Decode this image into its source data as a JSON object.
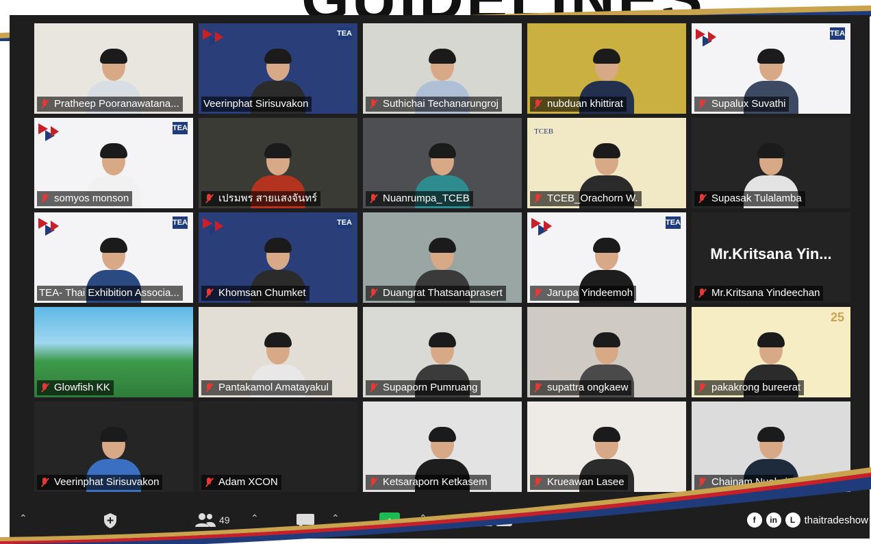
{
  "banner": {
    "text": "GUIDELINES"
  },
  "participants": [
    {
      "name": "Pratheep Pooranawatana...",
      "bg": "#e9e6df",
      "shirt": "#d9dde4",
      "muted": true
    },
    {
      "name": "Veerinphat Sirisuvakon",
      "bg": "#2a3f7a",
      "shirt": "#2b2b2b",
      "muted": false,
      "active": true,
      "logo": "TEA"
    },
    {
      "name": "Suthichai Techanarungroj",
      "bg": "#d7d7d2",
      "shirt": "#aebfd6",
      "muted": true
    },
    {
      "name": "nubduan khittirat",
      "bg": "#c9b040",
      "shirt": "#23314f",
      "muted": true
    },
    {
      "name": "Supalux Suvathi",
      "bg": "#f4f4f6",
      "shirt": "#3c4a63",
      "muted": true,
      "logo": "TEA"
    },
    {
      "name": "somyos monson",
      "bg": "#f4f4f6",
      "shirt": "#f1f1f1",
      "muted": true,
      "logo": "TEA"
    },
    {
      "name": "เปรมพร สายแสงจันทร์",
      "bg": "#3b3b36",
      "shirt": "#b3331f",
      "muted": true
    },
    {
      "name": "Nuanrumpa_TCEB",
      "bg": "#4d4f52",
      "shirt": "#2e8c8f",
      "muted": true
    },
    {
      "name": "TCEB_Orachorn W.",
      "bg": "#f1e8c6",
      "shirt": "#2b2b2b",
      "muted": true,
      "logo": "TCEB"
    },
    {
      "name": "Supasak Tulalamba",
      "bg": "#252525",
      "shirt": "#e3e3e3",
      "muted": true
    },
    {
      "name": "TEA- Thai Exhibition Associa...",
      "bg": "#f4f4f6",
      "shirt": "#2c4a82",
      "muted": false,
      "logo": "TEA"
    },
    {
      "name": "Khomsan Chumket",
      "bg": "#2a3f7a",
      "shirt": "#2b2b2b",
      "muted": true,
      "logo": "TEA"
    },
    {
      "name": "Duangrat Thatsanaprasert",
      "bg": "#9aa6a4",
      "shirt": "#3a3a3a",
      "muted": true
    },
    {
      "name": "Jarupa Yindeemoh",
      "bg": "#f4f4f6",
      "shirt": "#1d1d1d",
      "muted": true,
      "logo": "TEA"
    },
    {
      "name": "Mr.Kritsana Yindeechan",
      "bg": "#232323",
      "muted": true,
      "nameplate": "Mr.Kritsana  Yin..."
    },
    {
      "name": "Glowfish KK",
      "bg": "#3d9a4a",
      "muted": true,
      "cartoon": true
    },
    {
      "name": "Pantakamol Amatayakul",
      "bg": "#e2ded6",
      "shirt": "#e8e8e8",
      "muted": true
    },
    {
      "name": "Supaporn Pumruang",
      "bg": "#d9d9d6",
      "shirt": "#3b3b3b",
      "muted": true
    },
    {
      "name": "supattra ongkaew",
      "bg": "#cfcac3",
      "shirt": "#4a4a4a",
      "muted": true
    },
    {
      "name": "pakakrong bureerat",
      "bg": "#f6edc4",
      "shirt": "#2b2b2b",
      "muted": true,
      "logo": "25"
    },
    {
      "name": "Veerinphat Sirisuvakon",
      "bg": "#252525",
      "shirt": "#3a6fc1",
      "muted": true
    },
    {
      "name": "Adam XCON",
      "bg": "#232323",
      "muted": true,
      "empty": true
    },
    {
      "name": "Ketsaraporn Ketkasem",
      "bg": "#e3e3e3",
      "shirt": "#1d1d1d",
      "muted": true
    },
    {
      "name": "Krueawan Lasee",
      "bg": "#eeeae6",
      "shirt": "#2b2b2b",
      "muted": true
    },
    {
      "name": "Chainam Nualmit",
      "bg": "#dcdcdc",
      "shirt": "#1d2b3c",
      "muted": true
    }
  ],
  "toolbar": {
    "participants_count": "49",
    "share_label": "↑"
  },
  "social": {
    "handle": "thaitradeshow"
  },
  "colors": {
    "brand_blue": "#1f3b79",
    "accent_red": "#c8202a",
    "gold": "#c9a34e",
    "share_green": "#1db954"
  }
}
